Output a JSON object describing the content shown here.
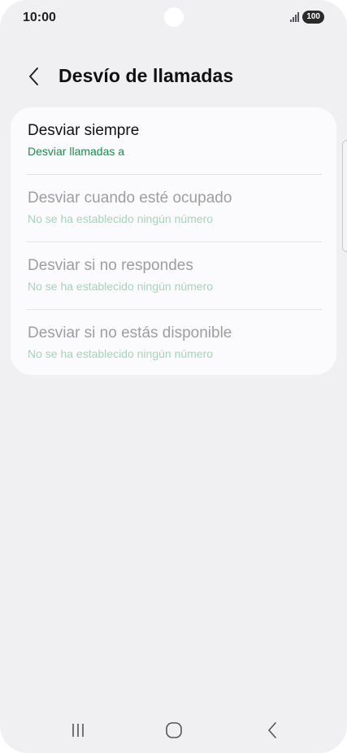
{
  "status_bar": {
    "time": "10:00",
    "battery": "100",
    "signal_icon": "signal-bars-icon"
  },
  "header": {
    "title": "Desvío de llamadas",
    "back_icon": "chevron-left-icon"
  },
  "options": [
    {
      "title": "Desviar siempre",
      "subtitle": "Desviar llamadas a",
      "enabled": true
    },
    {
      "title": "Desviar cuando esté ocupado",
      "subtitle": "No se ha establecido ningún número",
      "enabled": false
    },
    {
      "title": "Desviar si no respondes",
      "subtitle": "No se ha establecido ningún número",
      "enabled": false
    },
    {
      "title": "Desviar si no estás disponible",
      "subtitle": "No se ha establecido ningún número",
      "enabled": false
    }
  ],
  "nav_bar": {
    "recents_icon": "recents-icon",
    "home_icon": "home-icon",
    "back_icon": "back-icon"
  },
  "colors": {
    "background": "#f0f0f3",
    "card": "#fbfbfd",
    "accent_green": "#1d8a4e",
    "disabled_text": "#9d9da2",
    "disabled_green": "#a8d2b9"
  }
}
